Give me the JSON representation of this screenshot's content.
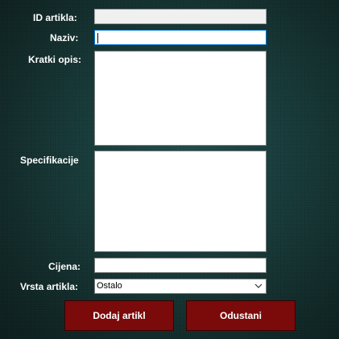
{
  "form": {
    "id_label": "ID artikla:",
    "id_value": "",
    "name_label": "Naziv:",
    "name_value": "",
    "short_desc_label": "Kratki opis:",
    "short_desc_value": "",
    "specs_label": "Specifikacije",
    "specs_value": "",
    "price_label": "Cijena:",
    "price_value": "",
    "type_label": "Vrsta artikla:",
    "type_value": "Ostalo"
  },
  "buttons": {
    "add_label": "Dodaj artikl",
    "cancel_label": "Odustani"
  },
  "icons": {
    "dropdown": "chevron-down-icon"
  },
  "colors": {
    "button_bg": "#7b0a0a",
    "focus_border": "#0078d7"
  }
}
